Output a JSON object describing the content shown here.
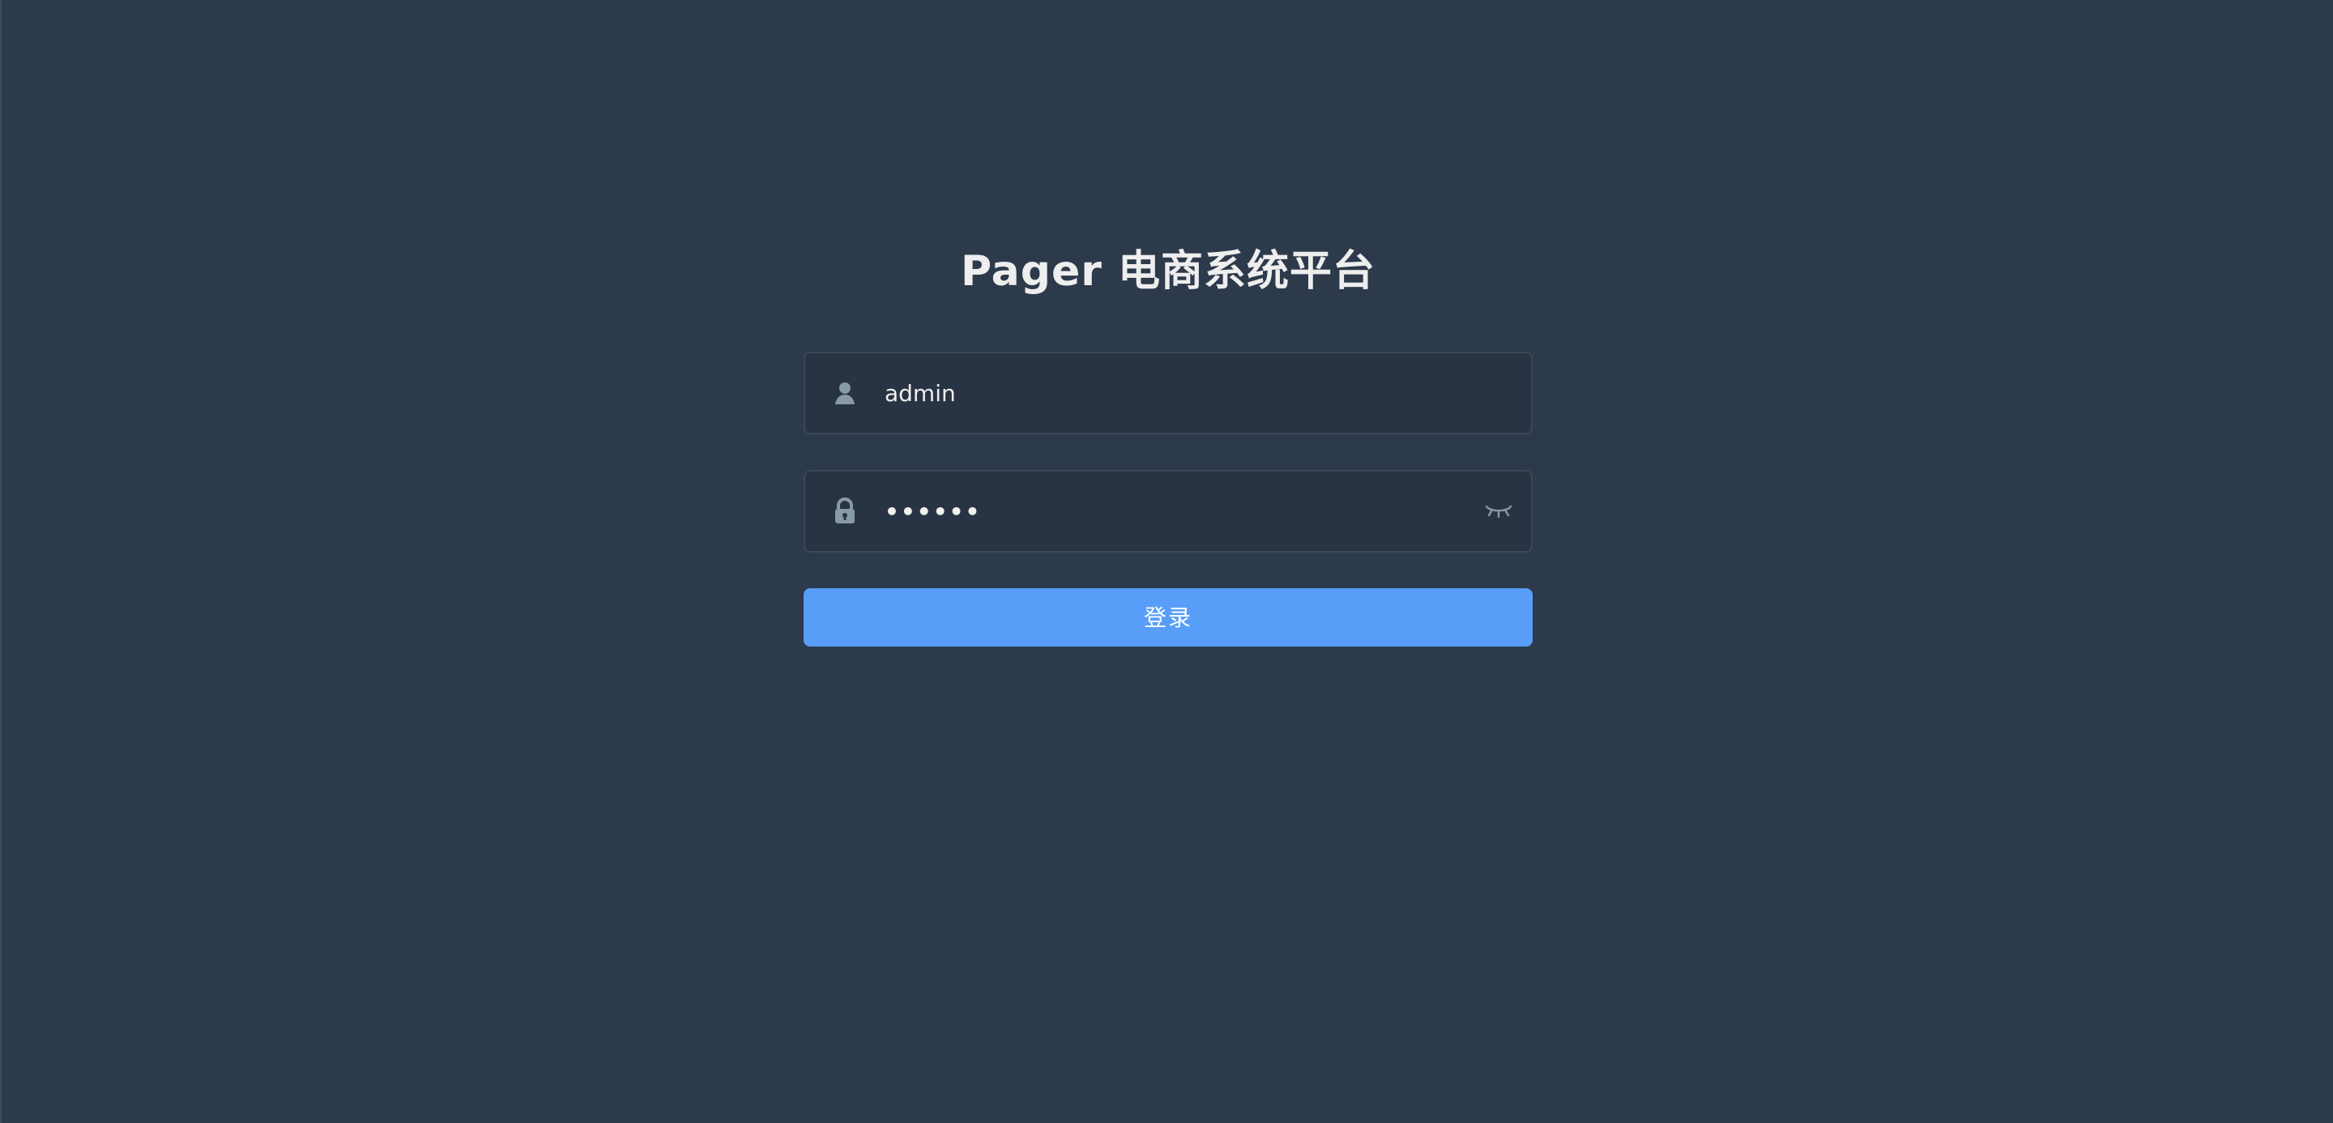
{
  "login": {
    "title": "Pager 电商系统平台",
    "username": {
      "value": "admin",
      "icon": "user-icon"
    },
    "password": {
      "value": "••••••",
      "icon": "lock-icon",
      "toggle_icon": "eye-closed-icon"
    },
    "submit_label": "登录"
  },
  "colors": {
    "background": "#2d3a4b",
    "input_background": "#283443",
    "button": "#589ef8",
    "text": "#eeeeee",
    "icon": "#889aa4"
  }
}
